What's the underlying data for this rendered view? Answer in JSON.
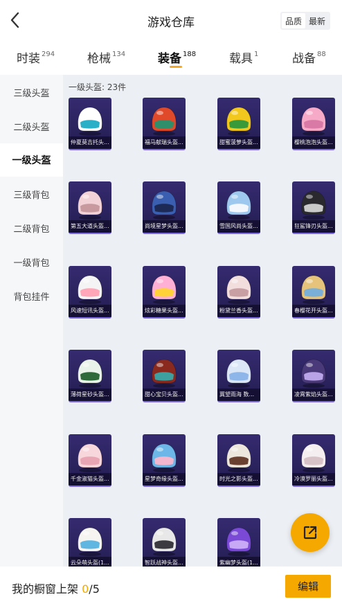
{
  "header": {
    "title": "游戏仓库",
    "sort_options": [
      "品质",
      "最新"
    ],
    "active_sort": 0
  },
  "category_tabs": [
    {
      "label": "时装",
      "count": "294"
    },
    {
      "label": "枪械",
      "count": "134"
    },
    {
      "label": "装备",
      "count": "188"
    },
    {
      "label": "载具",
      "count": "1"
    },
    {
      "label": "战备",
      "count": "88"
    }
  ],
  "active_tab": 2,
  "sidebar": {
    "items": [
      "三级头盔",
      "二级头盔",
      "一级头盔",
      "三级背包",
      "二级背包",
      "一级背包",
      "背包挂件"
    ],
    "active": 2
  },
  "section": {
    "title": "一级头盔: 23件"
  },
  "items": [
    {
      "name": "仲夏莫吉托头...",
      "color": "#ffffff",
      "accent": "#2bb0c8",
      "icon": "helmet-icon"
    },
    {
      "name": "福马献瑞头盔...",
      "color": "#e04a2a",
      "accent": "#2e8f6a",
      "icon": "helmet-icon"
    },
    {
      "name": "甜蜜菠萝头盔...",
      "color": "#f2c81e",
      "accent": "#3a9a3a",
      "icon": "helmet-icon"
    },
    {
      "name": "樱桃泡泡头盔...",
      "color": "#f7a9c8",
      "accent": "#d97aa6",
      "icon": "helmet-icon"
    },
    {
      "name": "第五大道头盔...",
      "color": "#f2d2d6",
      "accent": "#c89aa0",
      "icon": "helmet-icon"
    },
    {
      "name": "尚境星梦头盔...",
      "color": "#3b5fb0",
      "accent": "#1c2a55",
      "icon": "helmet-icon"
    },
    {
      "name": "雪国风尚头盔...",
      "color": "#9ec8ee",
      "accent": "#f4f7fb",
      "icon": "helmet-icon"
    },
    {
      "name": "狂鲨锋刃头盔...",
      "color": "#2a2a2e",
      "accent": "#c9c9c9",
      "icon": "helmet-icon"
    },
    {
      "name": "风速短讯头盔...",
      "color": "#f4f4f4",
      "accent": "#ffa6b8",
      "icon": "helmet-icon"
    },
    {
      "name": "炫彩糖果头盔...",
      "color": "#ffb0d4",
      "accent": "#ffd23a",
      "icon": "helmet-icon"
    },
    {
      "name": "粉黛兰香头盔...",
      "color": "#f3dede",
      "accent": "#c8a0a4",
      "icon": "helmet-icon"
    },
    {
      "name": "春樱花开头盔...",
      "color": "#e6c37a",
      "accent": "#7ab0d8",
      "icon": "helmet-icon"
    },
    {
      "name": "薄荷星砂头盔...",
      "color": "#eaf3ea",
      "accent": "#2f6a3a",
      "icon": "helmet-icon"
    },
    {
      "name": "甜心宝贝头盔...",
      "color": "#8a2a1e",
      "accent": "#3fa0a0",
      "icon": "helmet-icon"
    },
    {
      "name": "冀望雨海 数...",
      "color": "#dbe7f7",
      "accent": "#8fb6e8",
      "icon": "helmet-icon"
    },
    {
      "name": "凌霄紫焰头盔...",
      "color": "#4a3a7a",
      "accent": "#b9a4e8",
      "icon": "helmet-icon"
    },
    {
      "name": "千金淑猫头盔...",
      "color": "#f7d6dc",
      "accent": "#e8a6b4",
      "icon": "helmet-icon"
    },
    {
      "name": "星梦奇缘头盔...",
      "color": "#6cb6e8",
      "accent": "#f3b6cf",
      "icon": "helmet-icon"
    },
    {
      "name": "时光之影头盔...",
      "color": "#ece6dc",
      "accent": "#6a4030",
      "icon": "helmet-icon"
    },
    {
      "name": "冷漠罗丽头盔...",
      "color": "#f4eef0",
      "accent": "#d7c2c8",
      "icon": "helmet-icon"
    },
    {
      "name": "云朵萌头盔(1...",
      "color": "#f6f4f0",
      "accent": "#5fb6e0",
      "icon": "helmet-icon"
    },
    {
      "name": "智跃战神头盔...",
      "color": "#e8e8e8",
      "accent": "#3a3a40",
      "icon": "helmet-icon"
    },
    {
      "name": "紫幽梦头盔(1...",
      "color": "#7a4ad6",
      "accent": "#c7a9f5",
      "icon": "helmet-icon"
    }
  ],
  "fab": {
    "icon": "share-icon"
  },
  "footer": {
    "label": "我的橱窗上架",
    "current": "0",
    "total": "/5",
    "edit_label": "编辑"
  },
  "colors": {
    "accent": "#f5a800",
    "card_bg": "#2a235e",
    "sidebar_bg": "#f6f7f9",
    "main_bg": "#eceff3"
  }
}
